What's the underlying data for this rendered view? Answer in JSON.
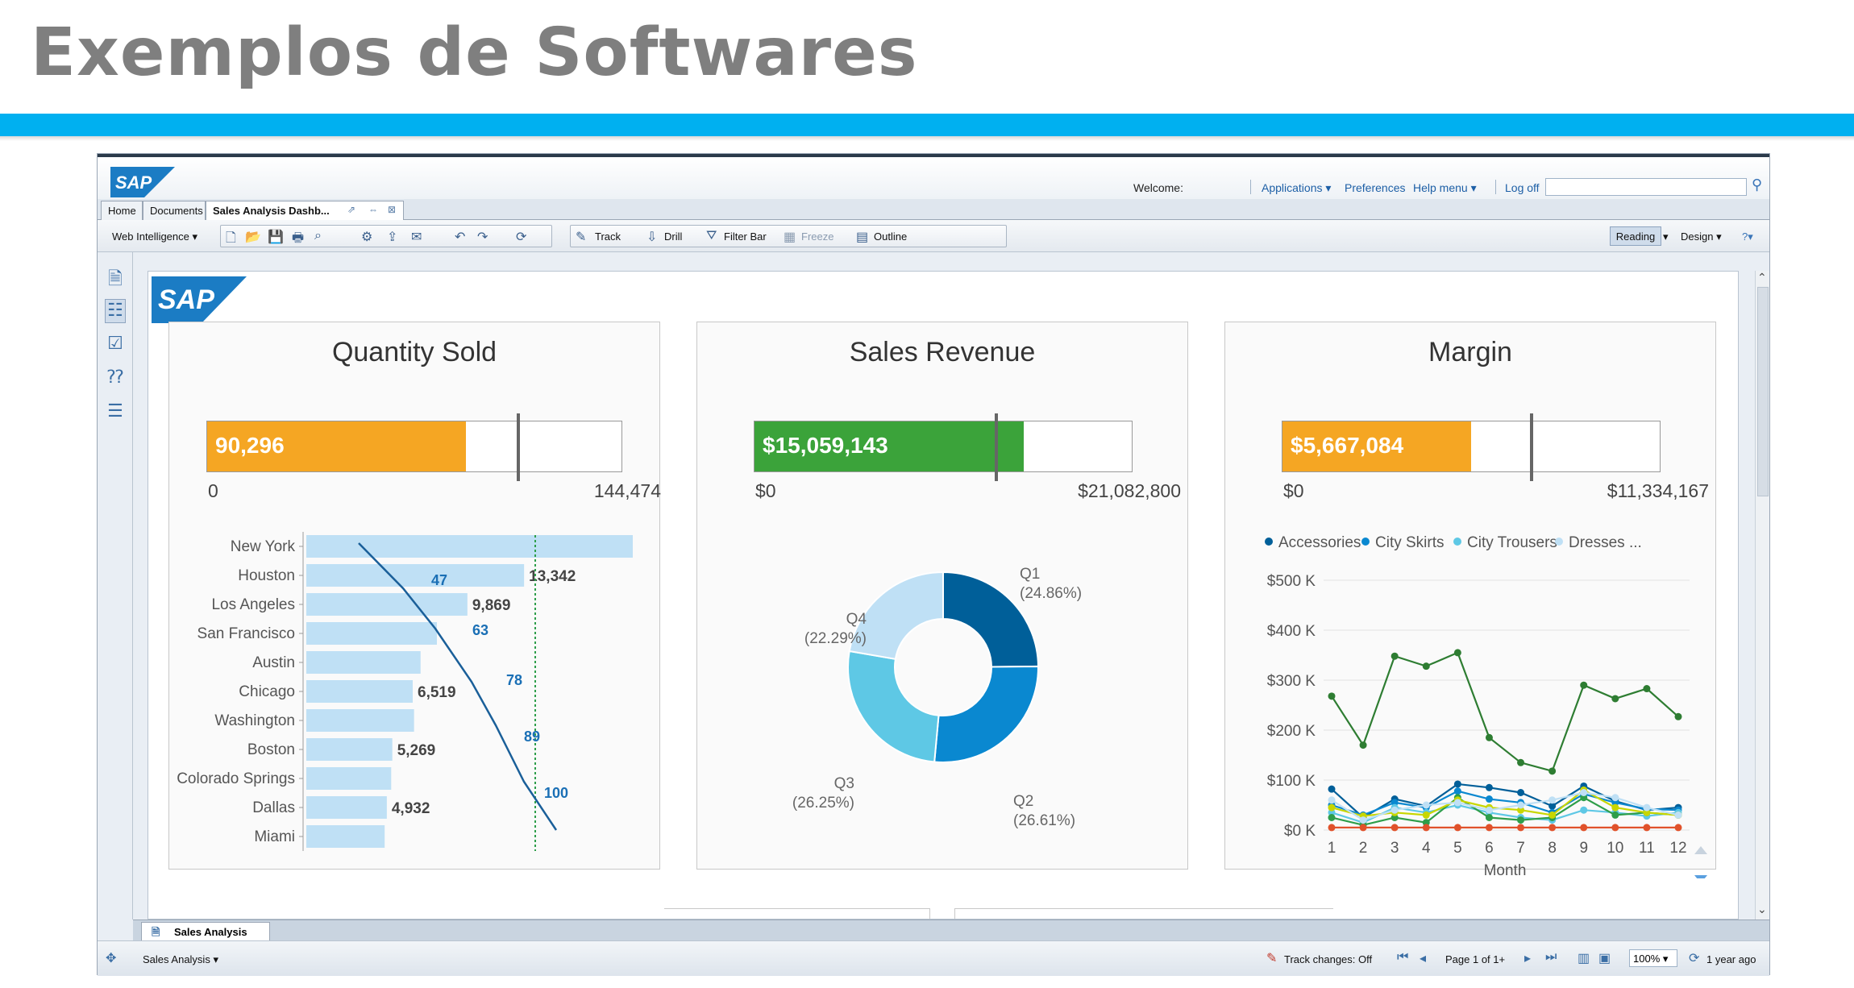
{
  "slide": {
    "title": "Exemplos de Softwares"
  },
  "header": {
    "logo": "SAP",
    "welcome": "Welcome:",
    "links": {
      "applications": "Applications",
      "preferences": "Preferences",
      "help_menu": "Help menu",
      "log_off": "Log off"
    }
  },
  "tabs": [
    {
      "label": "Home"
    },
    {
      "label": "Documents"
    },
    {
      "label": "Sales Analysis Dashb..."
    }
  ],
  "toolbar": {
    "app_menu": "Web Intelligence",
    "track": "Track",
    "drill": "Drill",
    "filter_bar": "Filter Bar",
    "freeze": "Freeze",
    "outline": "Outline",
    "reading": "Reading",
    "design": "Design"
  },
  "report": {
    "logo": "SAP",
    "panels": {
      "quantity": {
        "title": "Quantity Sold",
        "value": "90,296",
        "min": "0",
        "max": "144,474",
        "fraction": 0.625,
        "target": 0.75,
        "color": "#f5a623"
      },
      "revenue": {
        "title": "Sales Revenue",
        "value": "$15,059,143",
        "min": "$0",
        "max": "$21,082,800",
        "fraction": 0.714,
        "target": 0.64,
        "color": "#3ba33a"
      },
      "margin": {
        "title": "Margin",
        "value": "$5,667,084",
        "min": "$0",
        "max": "$11,334,167",
        "fraction": 0.5,
        "target": 0.66,
        "color": "#f5a623"
      }
    },
    "chart_data": [
      {
        "type": "bar",
        "title": "",
        "categories": [
          "New York",
          "Houston",
          "Los Angeles",
          "San Francisco",
          "Austin",
          "Chicago",
          "Washington",
          "Boston",
          "Colorado Springs",
          "Dallas",
          "Miami"
        ],
        "values": [
          20000,
          13342,
          9869,
          8000,
          7000,
          6519,
          6600,
          5269,
          5200,
          4932,
          4800
        ],
        "bar_labels": [
          "",
          "13,342",
          "9,869",
          "",
          "",
          "6,519",
          "",
          "5,269",
          "",
          "4,932",
          ""
        ],
        "pareto_labels": [
          "47",
          "63",
          "78",
          "89",
          "100"
        ],
        "pareto_values": [
          47,
          63,
          78,
          89,
          100
        ],
        "xlim": [
          0,
          20000
        ]
      },
      {
        "type": "pie",
        "title": "",
        "categories": [
          "Q1",
          "Q2",
          "Q3",
          "Q4"
        ],
        "values": [
          24.86,
          26.61,
          26.25,
          22.29
        ],
        "labels": [
          "(24.86%)",
          "(26.61%)",
          "(26.25%)",
          "(22.29%)"
        ],
        "colors": [
          "#005f99",
          "#0a88d0",
          "#5ec8e5",
          "#bfe0f5"
        ]
      },
      {
        "type": "line",
        "title": "",
        "xlabel": "Month",
        "ylabel": "",
        "x": [
          1,
          2,
          3,
          4,
          5,
          6,
          7,
          8,
          9,
          10,
          11,
          12
        ],
        "ylim": [
          0,
          500
        ],
        "yticks": [
          "$0 K",
          "$100 K",
          "$200 K",
          "$300 K",
          "$400 K",
          "$500 K"
        ],
        "legend": [
          "Accessories",
          "City Skirts",
          "City Trousers",
          "Dresses ..."
        ],
        "legend_colors": [
          "#005f99",
          "#0a88d0",
          "#5ec8e5",
          "#bfe0f5"
        ],
        "series": [
          {
            "values": [
              268,
              170,
              348,
              328,
              355,
              185,
              135,
              118,
              290,
              263,
              283,
              227
            ],
            "color": "#2e7d32"
          },
          {
            "values": [
              82,
              25,
              62,
              48,
              92,
              85,
              75,
              48,
              88,
              58,
              40,
              45
            ],
            "color": "#005f99"
          },
          {
            "values": [
              50,
              30,
              55,
              45,
              78,
              62,
              55,
              35,
              72,
              55,
              42,
              40
            ],
            "color": "#0a88d0"
          },
          {
            "values": [
              35,
              15,
              45,
              35,
              50,
              35,
              25,
              20,
              40,
              35,
              28,
              35
            ],
            "color": "#5ec8e5"
          },
          {
            "values": [
              25,
              10,
              25,
              15,
              65,
              25,
              20,
              25,
              65,
              30,
              35,
              30
            ],
            "color": "#2e9e4a"
          },
          {
            "values": [
              45,
              28,
              35,
              30,
              60,
              45,
              40,
              30,
              80,
              45,
              35,
              30
            ],
            "color": "#c8d600"
          },
          {
            "values": [
              60,
              20,
              40,
              50,
              55,
              40,
              50,
              60,
              75,
              65,
              45,
              30
            ],
            "color": "#bfe0f5"
          },
          {
            "values": [
              5,
              5,
              5,
              5,
              5,
              5,
              5,
              5,
              5,
              5,
              5,
              5
            ],
            "color": "#e0522b"
          }
        ]
      }
    ]
  },
  "bottom": {
    "report_tab": "Sales Analysis"
  },
  "status": {
    "doc_name": "Sales Analysis",
    "track_changes": "Track changes: Off",
    "page": "Page 1 of 1+",
    "zoom": "100%",
    "refresh": "1 year ago"
  }
}
